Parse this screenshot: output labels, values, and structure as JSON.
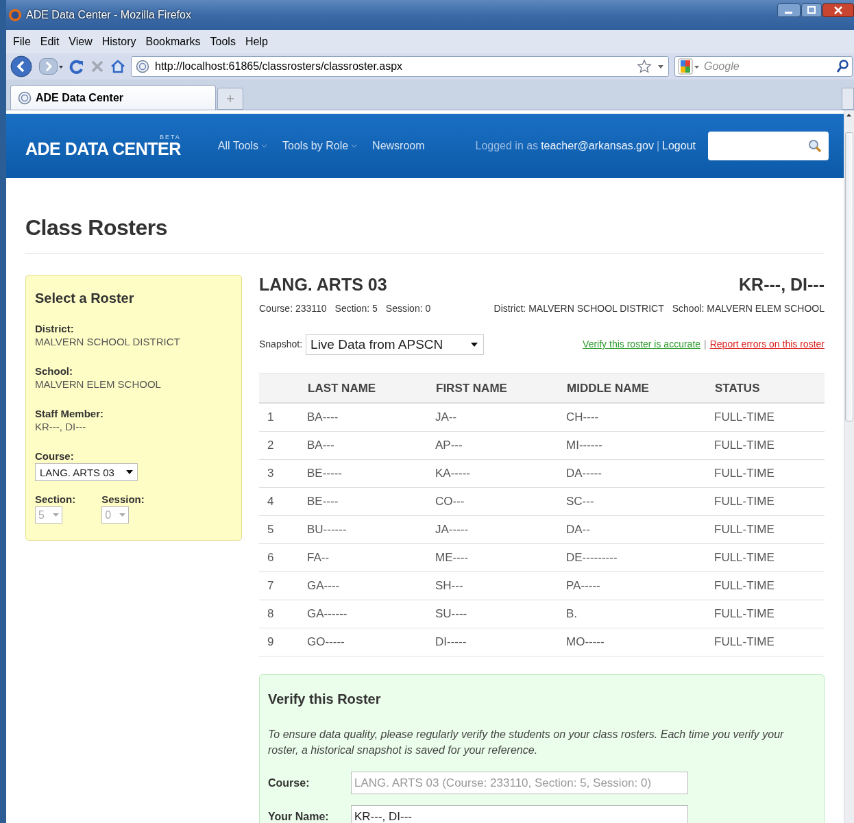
{
  "window": {
    "title": "ADE Data Center - Mozilla Firefox"
  },
  "menu": [
    "File",
    "Edit",
    "View",
    "History",
    "Bookmarks",
    "Tools",
    "Help"
  ],
  "address_bar": {
    "value": "http://localhost:61865/classrosters/classroster.aspx"
  },
  "search_bar": {
    "placeholder": "Google"
  },
  "tabs": [
    {
      "label": "ADE Data Center",
      "selected": true
    }
  ],
  "header": {
    "logo": "ADE DATA CENTER",
    "badge": "BETA",
    "nav": [
      {
        "label": "All Tools",
        "dropdown": true
      },
      {
        "label": "Tools by Role",
        "dropdown": true
      },
      {
        "label": "Newsroom",
        "dropdown": false
      }
    ],
    "login_prefix": "Logged in as",
    "user": "teacher@arkansas.gov",
    "separator": "|",
    "logout": "Logout"
  },
  "page_title": "Class Rosters",
  "sidebar": {
    "title": "Select a Roster",
    "fields": [
      {
        "label": "District:",
        "value": "MALVERN SCHOOL DISTRICT"
      },
      {
        "label": "School:",
        "value": "MALVERN ELEM SCHOOL"
      },
      {
        "label": "Staff Member:",
        "value": "KR---, DI---"
      }
    ],
    "course": {
      "label": "Course:",
      "value": "LANG. ARTS 03"
    },
    "section": {
      "label": "Section:",
      "value": "5",
      "disabled": true
    },
    "session": {
      "label": "Session:",
      "value": "0",
      "disabled": true
    }
  },
  "roster": {
    "title": "LANG. ARTS 03",
    "teacher": "KR---, DI---",
    "meta": [
      "Course: 233110",
      "Section: 5",
      "Session: 0"
    ],
    "location": [
      "District: MALVERN SCHOOL DISTRICT",
      "School: MALVERN ELEM SCHOOL"
    ],
    "snapshot_label": "Snapshot:",
    "snapshot": "Live Data from APSCN",
    "verify_link": "Verify this roster is accurate",
    "link_separator": "|",
    "report_link": "Report errors on this roster",
    "columns": [
      "",
      "LAST NAME",
      "FIRST NAME",
      "MIDDLE NAME",
      "STATUS"
    ],
    "rows": [
      [
        "1",
        "BA----",
        "JA--",
        "CH----",
        "FULL-TIME"
      ],
      [
        "2",
        "BA---",
        "AP---",
        "MI------",
        "FULL-TIME"
      ],
      [
        "3",
        "BE-----",
        "KA-----",
        "DA-----",
        "FULL-TIME"
      ],
      [
        "4",
        "BE----",
        "CO---",
        "SC---",
        "FULL-TIME"
      ],
      [
        "5",
        "BU------",
        "JA-----",
        "DA--",
        "FULL-TIME"
      ],
      [
        "6",
        "FA--",
        "ME----",
        "DE---------",
        "FULL-TIME"
      ],
      [
        "7",
        "GA----",
        "SH---",
        "PA-----",
        "FULL-TIME"
      ],
      [
        "8",
        "GA------",
        "SU----",
        "B.",
        "FULL-TIME"
      ],
      [
        "9",
        "GO-----",
        "DI-----",
        "MO-----",
        "FULL-TIME"
      ]
    ]
  },
  "verify": {
    "title": "Verify this Roster",
    "description": "To ensure data quality, please regularly verify the students on your class rosters. Each time you verify your roster, a historical snapshot is saved for your reference.",
    "fields": [
      {
        "label": "Course:",
        "value": "LANG. ARTS 03 (Course: 233110, Section: 5, Session: 0)",
        "disabled": true
      },
      {
        "label": "Your Name:",
        "value": "KR---, DI---",
        "disabled": false
      }
    ]
  }
}
